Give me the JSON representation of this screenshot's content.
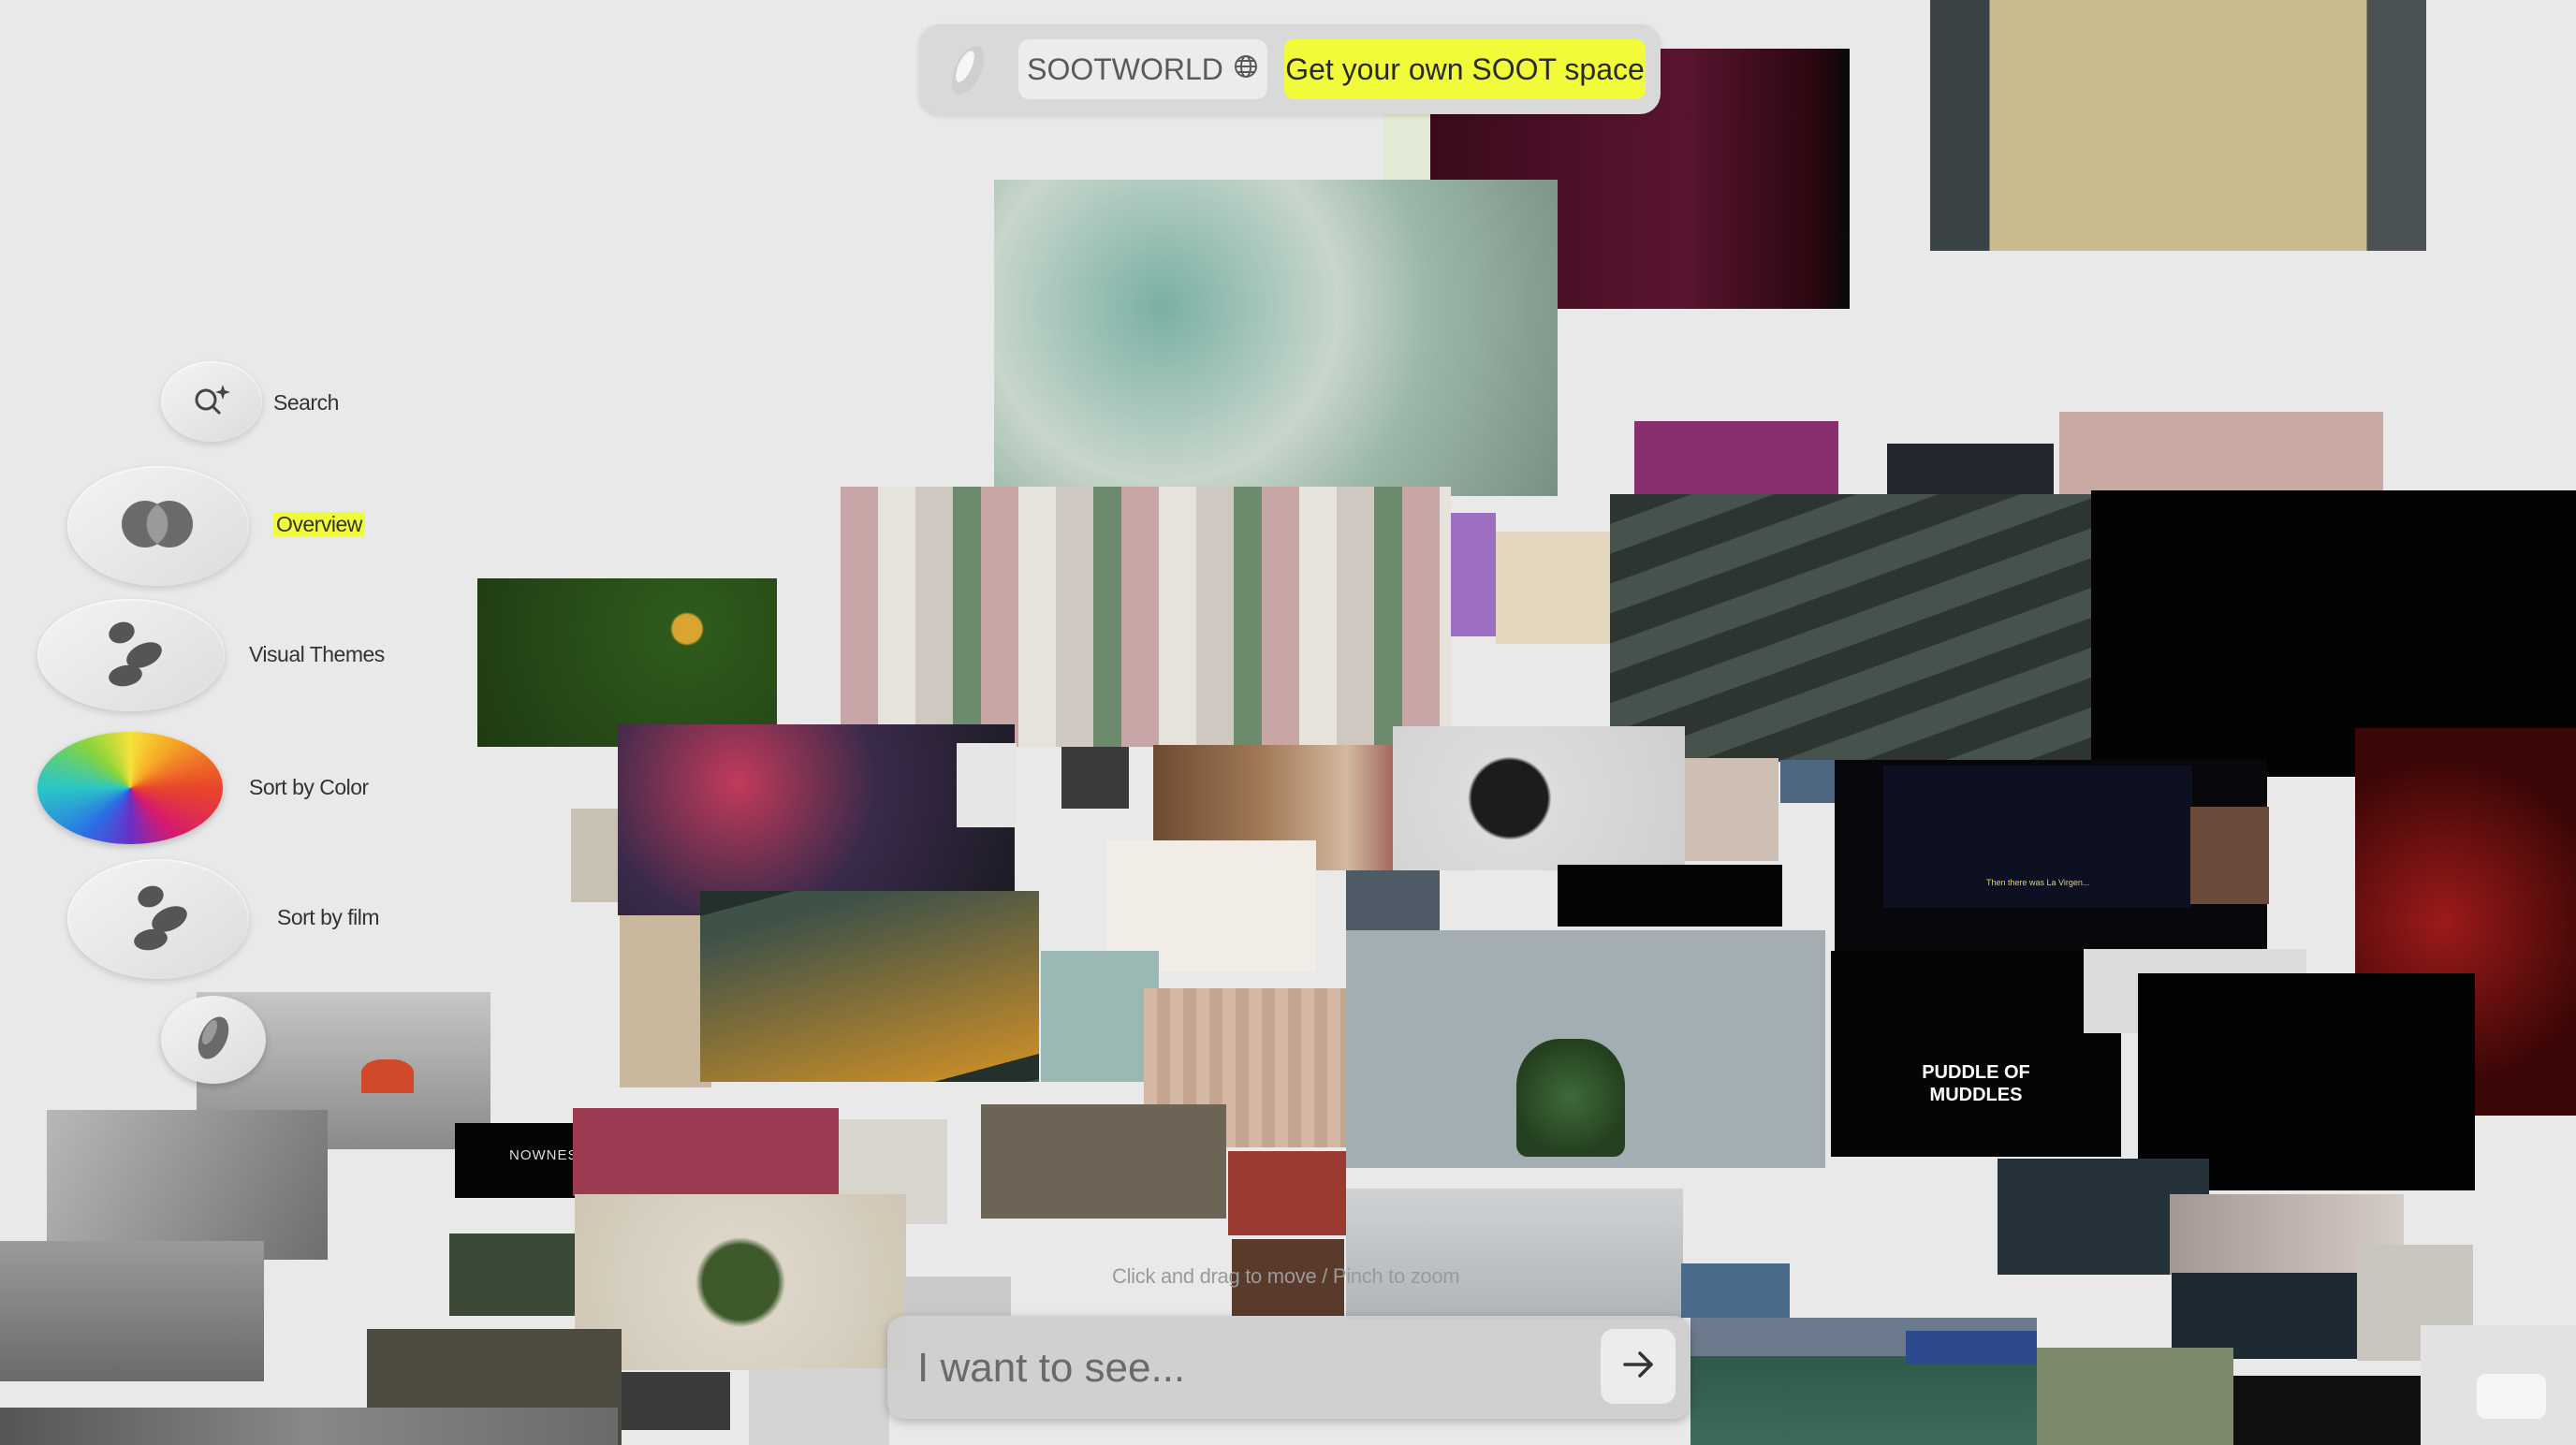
{
  "header": {
    "brand_label": "SOOTWORLD",
    "globe_icon": "globe-icon",
    "cta_label": "Get your own SOOT space",
    "accent_color": "#f2fb3a"
  },
  "nav": {
    "items": [
      {
        "label": "Search",
        "icon": "sparkle-search-icon"
      },
      {
        "label": "Overview",
        "icon": "overlap-circles-icon",
        "active": true
      },
      {
        "label": "Visual Themes",
        "icon": "pebbles-icon"
      },
      {
        "label": "Sort by Color",
        "icon": "color-wheel-icon"
      },
      {
        "label": "Sort by film",
        "icon": "pebbles-icon"
      }
    ]
  },
  "collage": {
    "tile_labels": {
      "puddle_title": "PUDDLE OF MUDDLES",
      "subtitle_caption": "Then there was La Virgen...",
      "nowness_badge": "NOWNESS"
    }
  },
  "canvas_hint": "Click and drag to move / Pinch to zoom",
  "search": {
    "placeholder": "I want to see...",
    "submit_icon": "arrow-right-icon"
  }
}
